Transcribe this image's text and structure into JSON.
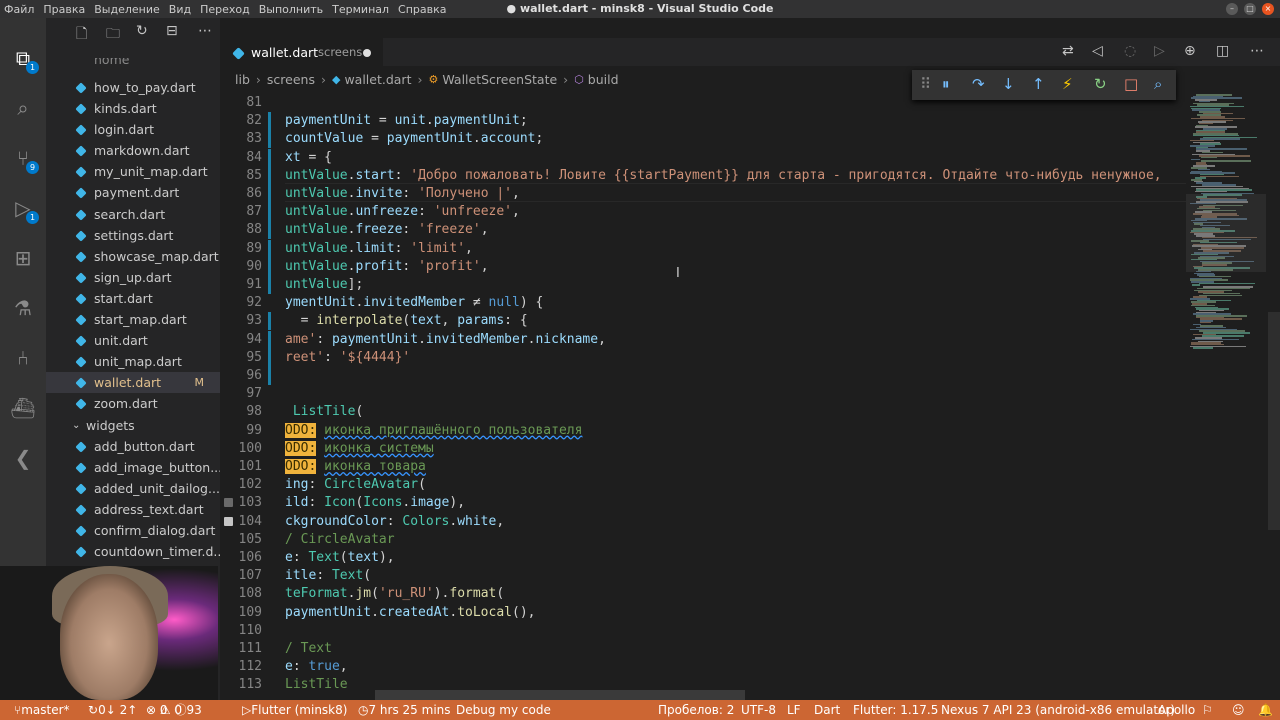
{
  "window": {
    "title": "● wallet.dart - minsk8 - Visual Studio Code",
    "menu": [
      "Файл",
      "Правка",
      "Выделение",
      "Вид",
      "Переход",
      "Выполнить",
      "Терминал",
      "Справка"
    ]
  },
  "activity_bar": {
    "explorer_badge": "1",
    "search_badge": "",
    "scm_badge": "9",
    "debug_badge": "1"
  },
  "explorer": {
    "cut_item": "home",
    "files": [
      {
        "name": "how_to_pay.dart",
        "mod": ""
      },
      {
        "name": "kinds.dart",
        "mod": ""
      },
      {
        "name": "login.dart",
        "mod": ""
      },
      {
        "name": "markdown.dart",
        "mod": ""
      },
      {
        "name": "my_unit_map.dart",
        "mod": ""
      },
      {
        "name": "payment.dart",
        "mod": ""
      },
      {
        "name": "search.dart",
        "mod": ""
      },
      {
        "name": "settings.dart",
        "mod": ""
      },
      {
        "name": "showcase_map.dart",
        "mod": ""
      },
      {
        "name": "sign_up.dart",
        "mod": ""
      },
      {
        "name": "start.dart",
        "mod": ""
      },
      {
        "name": "start_map.dart",
        "mod": ""
      },
      {
        "name": "unit.dart",
        "mod": ""
      },
      {
        "name": "unit_map.dart",
        "mod": ""
      },
      {
        "name": "wallet.dart",
        "mod": "M"
      },
      {
        "name": "zoom.dart",
        "mod": ""
      }
    ],
    "folder": "widgets",
    "widget_files": [
      "add_button.dart",
      "add_image_button....",
      "added_unit_dailog....",
      "address_text.dart",
      "confirm_dialog.dart",
      "countdown_timer.d..."
    ]
  },
  "tab": {
    "name": "wallet.dart",
    "description": "screens"
  },
  "breadcrumb": [
    "lib",
    "screens",
    "wallet.dart",
    "WalletScreenState",
    "build"
  ],
  "code_lines": [
    {
      "n": "81",
      "html": ""
    },
    {
      "n": "82",
      "html": "<span class='c-var'>paymentUnit</span> = <span class='c-var'>unit</span>.<span class='c-var'>paymentUnit</span>;"
    },
    {
      "n": "83",
      "html": "<span class='c-var'>countValue</span> = <span class='c-var'>paymentUnit</span>.<span class='c-var'>account</span>;"
    },
    {
      "n": "84",
      "html": "<span class='c-var'>xt</span> = {"
    },
    {
      "n": "85",
      "html": "<span class='c-cls'>untValue</span>.<span class='c-var'>start</span>: <span class='c-str'>'Добро пожаловать! Ловите {{startPayment}} для старта - пригодятся. Отдайте что-нибудь ненужное,</span>"
    },
    {
      "n": "86",
      "html": "<span class='c-cls'>untValue</span>.<span class='c-var'>invite</span>: <span class='c-str'>'Получено |'</span>,"
    },
    {
      "n": "87",
      "html": "<span class='c-cls'>untValue</span>.<span class='c-var'>unfreeze</span>: <span class='c-str'>'unfreeze'</span>,"
    },
    {
      "n": "88",
      "html": "<span class='c-cls'>untValue</span>.<span class='c-var'>freeze</span>: <span class='c-str'>'freeze'</span>,"
    },
    {
      "n": "89",
      "html": "<span class='c-cls'>untValue</span>.<span class='c-var'>limit</span>: <span class='c-str'>'limit'</span>,"
    },
    {
      "n": "90",
      "html": "<span class='c-cls'>untValue</span>.<span class='c-var'>profit</span>: <span class='c-str'>'profit'</span>,"
    },
    {
      "n": "91",
      "html": "<span class='c-cls'>untValue</span>];"
    },
    {
      "n": "92",
      "html": "<span class='c-var'>ymentUnit</span>.<span class='c-var'>invitedMember</span> ≠ <span class='c-kw'>null</span>) {"
    },
    {
      "n": "93",
      "html": "  = <span class='c-fn'>interpolate</span>(<span class='c-var'>text</span>, <span class='c-var'>params</span>: {"
    },
    {
      "n": "94",
      "html": "<span class='c-str'>ame'</span>: <span class='c-var'>paymentUnit</span>.<span class='c-var'>invitedMember</span>.<span class='c-var'>nickname</span>,"
    },
    {
      "n": "95",
      "html": "<span class='c-str'>reet'</span>: <span class='c-str'>'${4444}'</span>"
    },
    {
      "n": "96",
      "html": ""
    },
    {
      "n": "97",
      "html": ""
    },
    {
      "n": "98",
      "html": " <span class='c-cls'>ListTile</span>("
    },
    {
      "n": "99",
      "html": "<span class='c-todo'>ODO:</span> <span class='c-cmt wavy'>иконка приглашённого пользователя</span>"
    },
    {
      "n": "100",
      "html": "<span class='c-todo'>ODO:</span> <span class='c-cmt wavy'>иконка системы</span>"
    },
    {
      "n": "101",
      "html": "<span class='c-todo'>ODO:</span> <span class='c-cmt wavy'>иконка товара</span>"
    },
    {
      "n": "102",
      "html": "<span class='c-var'>ing</span>: <span class='c-cls'>CircleAvatar</span>("
    },
    {
      "n": "103",
      "html": "<span class='c-var'>ild</span>: <span class='c-cls'>Icon</span>(<span class='c-cls'>Icons</span>.<span class='c-var'>image</span>),"
    },
    {
      "n": "104",
      "html": "<span class='c-var'>ckgroundColor</span>: <span class='c-cls'>Colors</span>.<span class='c-var'>white</span>,"
    },
    {
      "n": "105",
      "html": "<span class='c-cmt'>/ CircleAvatar</span>"
    },
    {
      "n": "106",
      "html": "<span class='c-var'>e</span>: <span class='c-cls'>Text</span>(<span class='c-var'>text</span>),"
    },
    {
      "n": "107",
      "html": "<span class='c-var'>itle</span>: <span class='c-cls'>Text</span>("
    },
    {
      "n": "108",
      "html": "<span class='c-cls'>teFormat</span>.<span class='c-fn'>jm</span>(<span class='c-str'>'ru_RU'</span>).<span class='c-fn'>format</span>("
    },
    {
      "n": "109",
      "html": "<span class='c-var'>paymentUnit</span>.<span class='c-var'>createdAt</span>.<span class='c-fn'>toLocal</span>(),"
    },
    {
      "n": "110",
      "html": ""
    },
    {
      "n": "111",
      "html": "<span class='c-cmt'>/ Text</span>"
    },
    {
      "n": "112",
      "html": "<span class='c-var'>e</span>: <span class='c-kw'>true</span>,"
    },
    {
      "n": "113",
      "html": "<span class='c-cmt'>ListTile</span>"
    }
  ],
  "status": {
    "branch": "master*",
    "sync": "0↓ 2↑",
    "problems": "0",
    "warnings": "0",
    "infos": "93",
    "launch": "Flutter (minsk8)",
    "time": "7 hrs 25 mins",
    "debug": "Debug my code",
    "indent": "Пробелов: 2",
    "encoding": "UTF-8",
    "eol": "LF",
    "language": "Dart",
    "flutter": "Flutter: 1.17.5",
    "device": "Nexus 7 API 23 (android-x86 emulator)",
    "apollo": "Apollo"
  }
}
